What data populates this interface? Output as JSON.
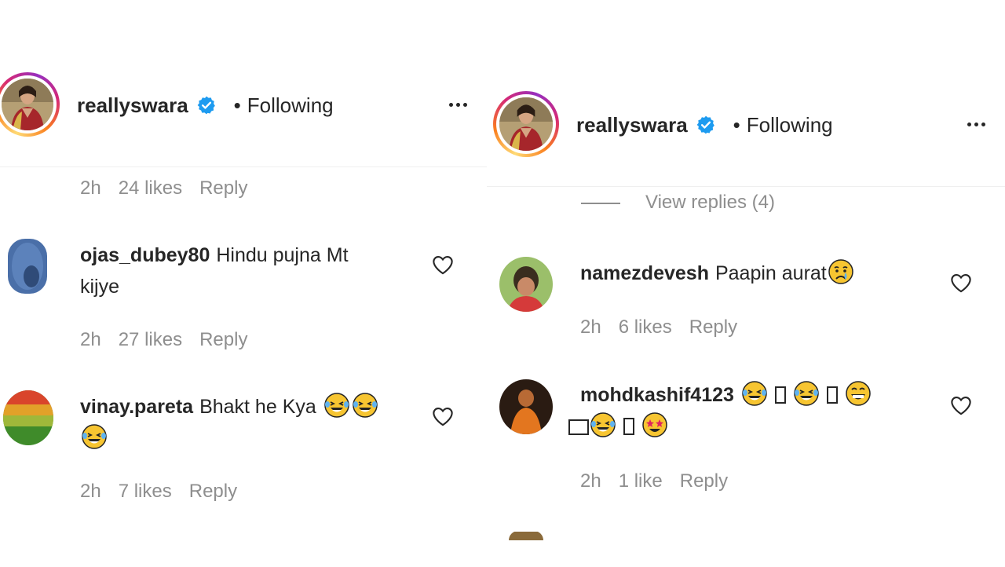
{
  "left_panel": {
    "header": {
      "username": "reallyswara",
      "separator": "•",
      "following": "Following"
    },
    "post_meta": {
      "time": "2h",
      "likes": "24 likes",
      "reply": "Reply"
    },
    "comments": [
      {
        "username": "ojas_dubey80",
        "text_line1": "Hindu pujna Mt",
        "text_line2": "kijye",
        "time": "2h",
        "likes": "27 likes",
        "reply": "Reply"
      },
      {
        "username": "vinay.pareta",
        "text": "Bhakt he Kya",
        "emojis": [
          "laughing-tears-emoji",
          "laughing-tears-emoji",
          "laughing-tears-emoji"
        ],
        "time": "2h",
        "likes": "7 likes",
        "reply": "Reply"
      }
    ]
  },
  "right_panel": {
    "header": {
      "username": "reallyswara",
      "separator": "•",
      "following": "Following"
    },
    "view_replies": "View replies (4)",
    "comments": [
      {
        "username": "namezdevesh",
        "text": "Paapin aurat",
        "emojis": [
          "crying-emoji"
        ],
        "time": "2h",
        "likes": "6 likes",
        "reply": "Reply"
      },
      {
        "username": "mohdkashif4123",
        "emojis": [
          "laughing-tears-emoji",
          "laughing-tears-emoji",
          "grinning-emoji",
          "laughing-tears-emoji",
          "star-struck-emoji"
        ],
        "time": "2h",
        "likes": "1 like",
        "reply": "Reply"
      }
    ]
  },
  "colors": {
    "verified": "#1d9bf0",
    "meta_gray": "#8e8e8e",
    "text": "#262626",
    "emoji_yellow": "#f7c531"
  },
  "icons": [
    "verified-badge-icon",
    "more-options-icon",
    "heart-icon"
  ]
}
